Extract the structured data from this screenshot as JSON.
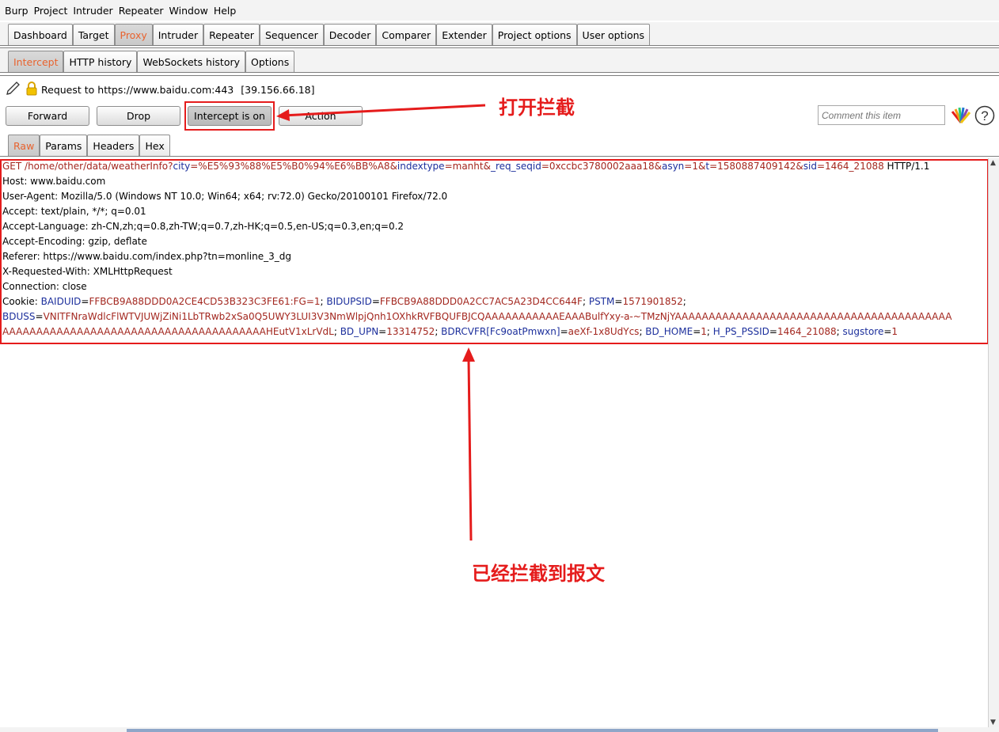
{
  "menu": [
    "Burp",
    "Project",
    "Intruder",
    "Repeater",
    "Window",
    "Help"
  ],
  "main_tabs": [
    {
      "label": "Dashboard",
      "active": false
    },
    {
      "label": "Target",
      "active": false
    },
    {
      "label": "Proxy",
      "active": true
    },
    {
      "label": "Intruder",
      "active": false
    },
    {
      "label": "Repeater",
      "active": false
    },
    {
      "label": "Sequencer",
      "active": false
    },
    {
      "label": "Decoder",
      "active": false
    },
    {
      "label": "Comparer",
      "active": false
    },
    {
      "label": "Extender",
      "active": false
    },
    {
      "label": "Project options",
      "active": false
    },
    {
      "label": "User options",
      "active": false
    }
  ],
  "sub_tabs": [
    {
      "label": "Intercept",
      "active": true
    },
    {
      "label": "HTTP history",
      "active": false
    },
    {
      "label": "WebSockets history",
      "active": false
    },
    {
      "label": "Options",
      "active": false
    }
  ],
  "request_info": {
    "text": "Request to https://www.baidu.com:443",
    "ip": "[39.156.66.18]"
  },
  "buttons": {
    "forward": "Forward",
    "drop": "Drop",
    "intercept": "Intercept is on",
    "action": "Action"
  },
  "comment": {
    "placeholder": "Comment this item"
  },
  "view_tabs": [
    {
      "label": "Raw",
      "active": true
    },
    {
      "label": "Params",
      "active": false
    },
    {
      "label": "Headers",
      "active": false
    },
    {
      "label": "Hex",
      "active": false
    }
  ],
  "request": {
    "get_parts": [
      {
        "t": "GET /home/other/data/weatherInfo?",
        "c": "pv"
      },
      {
        "t": "city",
        "c": "pn"
      },
      {
        "t": "=",
        "c": "pv"
      },
      {
        "t": "%E5%93%88%E5%B0%94%E6%BB%A8",
        "c": "pv"
      },
      {
        "t": "&",
        "c": "pv"
      },
      {
        "t": "indextype",
        "c": "pn"
      },
      {
        "t": "=",
        "c": "pv"
      },
      {
        "t": "manht",
        "c": "pv"
      },
      {
        "t": "&",
        "c": "pv"
      },
      {
        "t": "_req_seqid",
        "c": "pn"
      },
      {
        "t": "=",
        "c": "pv"
      },
      {
        "t": "0xccbc3780002aaa18",
        "c": "pv"
      },
      {
        "t": "&",
        "c": "pv"
      },
      {
        "t": "asyn",
        "c": "pn"
      },
      {
        "t": "=",
        "c": "pv"
      },
      {
        "t": "1",
        "c": "pv"
      },
      {
        "t": "&",
        "c": "pv"
      },
      {
        "t": "t",
        "c": "pn"
      },
      {
        "t": "=",
        "c": "pv"
      },
      {
        "t": "1580887409142",
        "c": "pv"
      },
      {
        "t": "&",
        "c": "pv"
      },
      {
        "t": "sid",
        "c": "pn"
      },
      {
        "t": "=",
        "c": "pv"
      },
      {
        "t": "1464_21088",
        "c": "pv"
      },
      {
        "t": " HTTP/1.1",
        "c": "plain"
      }
    ],
    "headers": [
      "Host: www.baidu.com",
      "User-Agent: Mozilla/5.0 (Windows NT 10.0; Win64; x64; rv:72.0) Gecko/20100101 Firefox/72.0",
      "Accept: text/plain, */*; q=0.01",
      "Accept-Language: zh-CN,zh;q=0.8,zh-TW;q=0.7,zh-HK;q=0.5,en-US;q=0.3,en;q=0.2",
      "Accept-Encoding: gzip, deflate",
      "Referer: https://www.baidu.com/index.php?tn=monline_3_dg",
      "X-Requested-With: XMLHttpRequest",
      "Connection: close"
    ],
    "cookie_line1": [
      {
        "t": "Cookie: ",
        "c": "plain"
      },
      {
        "t": "BAIDUID",
        "c": "ck"
      },
      {
        "t": "=",
        "c": "plain"
      },
      {
        "t": "FFBCB9A88DDD0A2CE4CD53B323C3FE61:FG=1",
        "c": "pv"
      },
      {
        "t": "; ",
        "c": "plain"
      },
      {
        "t": "BIDUPSID",
        "c": "ck"
      },
      {
        "t": "=",
        "c": "plain"
      },
      {
        "t": "FFBCB9A88DDD0A2CC7AC5A23D4CC644F",
        "c": "pv"
      },
      {
        "t": "; ",
        "c": "plain"
      },
      {
        "t": "PSTM",
        "c": "ck"
      },
      {
        "t": "=",
        "c": "plain"
      },
      {
        "t": "1571901852",
        "c": "pv"
      },
      {
        "t": ";",
        "c": "plain"
      }
    ],
    "cookie_line2": [
      {
        "t": "BDUSS",
        "c": "ck"
      },
      {
        "t": "=",
        "c": "plain"
      },
      {
        "t": "VNITFNraWdlcFlWTVJUWjZiNi1LbTRwb2xSa0Q5UWY3LUI3V3NmWlpjQnh1OXhkRVFBQUFBJCQAAAAAAAAAAAEAAABulfYxy-a-~TMzNjYAAAAAAAAAAAAAAAAAAAAAAAAAAAAAAAAAAAAAAAAA",
        "c": "pv"
      }
    ],
    "cookie_line3": [
      {
        "t": "AAAAAAAAAAAAAAAAAAAAAAAAAAAAAAAAAAAAAAAHEutV1xLrVdL",
        "c": "pv"
      },
      {
        "t": "; ",
        "c": "plain"
      },
      {
        "t": "BD_UPN",
        "c": "ck"
      },
      {
        "t": "=",
        "c": "plain"
      },
      {
        "t": "13314752",
        "c": "pv"
      },
      {
        "t": "; ",
        "c": "plain"
      },
      {
        "t": "BDRCVFR[Fc9oatPmwxn]",
        "c": "ck"
      },
      {
        "t": "=",
        "c": "plain"
      },
      {
        "t": "aeXf-1x8UdYcs",
        "c": "pv"
      },
      {
        "t": "; ",
        "c": "plain"
      },
      {
        "t": "BD_HOME",
        "c": "ck"
      },
      {
        "t": "=",
        "c": "plain"
      },
      {
        "t": "1",
        "c": "pv"
      },
      {
        "t": "; ",
        "c": "plain"
      },
      {
        "t": "H_PS_PSSID",
        "c": "ck"
      },
      {
        "t": "=",
        "c": "plain"
      },
      {
        "t": "1464_21088",
        "c": "pv"
      },
      {
        "t": "; ",
        "c": "plain"
      },
      {
        "t": "sugstore",
        "c": "ck"
      },
      {
        "t": "=",
        "c": "plain"
      },
      {
        "t": "1",
        "c": "pv"
      }
    ]
  },
  "annotations": {
    "open_intercept": "打开拦截",
    "intercepted": "已经拦截到报文"
  },
  "colors": {
    "accent_tab": "#e8632f",
    "annotation_red": "#e51c1c",
    "param_name": "#1c2f9c",
    "param_value": "#a3271f"
  }
}
